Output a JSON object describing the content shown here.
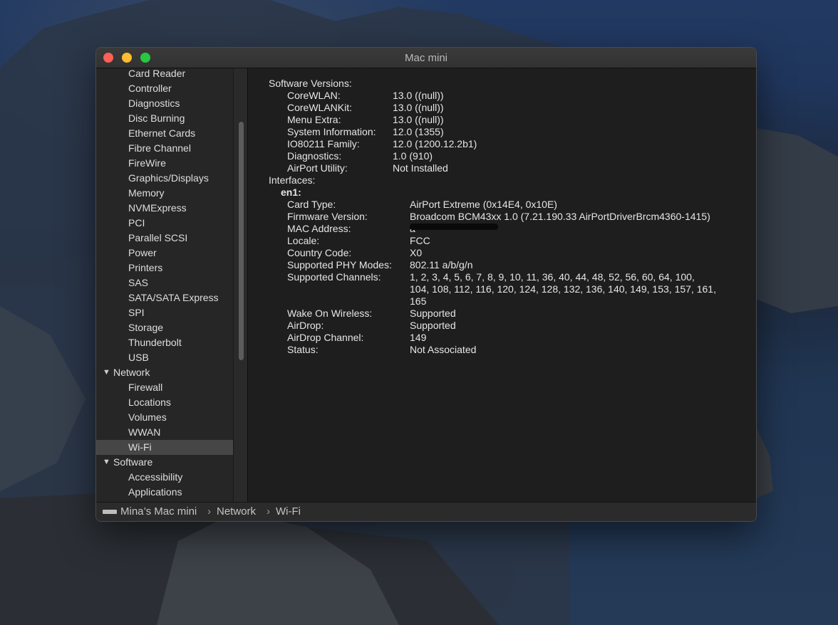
{
  "window": {
    "title": "Mac mini"
  },
  "sidebar": {
    "items": [
      {
        "label": "Card Reader",
        "level": 2
      },
      {
        "label": "Controller",
        "level": 2
      },
      {
        "label": "Diagnostics",
        "level": 2
      },
      {
        "label": "Disc Burning",
        "level": 2
      },
      {
        "label": "Ethernet Cards",
        "level": 2
      },
      {
        "label": "Fibre Channel",
        "level": 2
      },
      {
        "label": "FireWire",
        "level": 2
      },
      {
        "label": "Graphics/Displays",
        "level": 2
      },
      {
        "label": "Memory",
        "level": 2
      },
      {
        "label": "NVMExpress",
        "level": 2
      },
      {
        "label": "PCI",
        "level": 2
      },
      {
        "label": "Parallel SCSI",
        "level": 2
      },
      {
        "label": "Power",
        "level": 2
      },
      {
        "label": "Printers",
        "level": 2
      },
      {
        "label": "SAS",
        "level": 2
      },
      {
        "label": "SATA/SATA Express",
        "level": 2
      },
      {
        "label": "SPI",
        "level": 2
      },
      {
        "label": "Storage",
        "level": 2
      },
      {
        "label": "Thunderbolt",
        "level": 2
      },
      {
        "label": "USB",
        "level": 2
      },
      {
        "label": "Network",
        "level": 1,
        "expanded": true
      },
      {
        "label": "Firewall",
        "level": 2
      },
      {
        "label": "Locations",
        "level": 2
      },
      {
        "label": "Volumes",
        "level": 2
      },
      {
        "label": "WWAN",
        "level": 2
      },
      {
        "label": "Wi-Fi",
        "level": 2,
        "selected": true
      },
      {
        "label": "Software",
        "level": 1,
        "expanded": true
      },
      {
        "label": "Accessibility",
        "level": 2
      },
      {
        "label": "Applications",
        "level": 2
      }
    ],
    "expand_glyph": "▼"
  },
  "content": {
    "software_versions_heading": "Software Versions:",
    "software_versions": [
      {
        "label": "CoreWLAN:",
        "value": "13.0 ((null))"
      },
      {
        "label": "CoreWLANKit:",
        "value": "13.0 ((null))"
      },
      {
        "label": "Menu Extra:",
        "value": "13.0 ((null))"
      },
      {
        "label": "System Information:",
        "value": "12.0 (1355)"
      },
      {
        "label": "IO80211 Family:",
        "value": "12.0 (1200.12.2b1)"
      },
      {
        "label": "Diagnostics:",
        "value": "1.0 (910)"
      },
      {
        "label": "AirPort Utility:",
        "value": "Not Installed"
      }
    ],
    "interfaces_heading": "Interfaces:",
    "interface_name": "en1:",
    "interface_fields": [
      {
        "label": "Card Type:",
        "value": "AirPort Extreme  (0x14E4, 0x10E)"
      },
      {
        "label": "Firmware Version:",
        "value": "Broadcom BCM43xx 1.0 (7.21.190.33 AirPortDriverBrcm4360-1415)"
      },
      {
        "label": "MAC Address:",
        "value": "a"
      },
      {
        "label": "Locale:",
        "value": "FCC"
      },
      {
        "label": "Country Code:",
        "value": "X0"
      },
      {
        "label": "Supported PHY Modes:",
        "value": "802.11 a/b/g/n"
      },
      {
        "label": "Supported Channels:",
        "value": "1, 2, 3, 4, 5, 6, 7, 8, 9, 10, 11, 36, 40, 44, 48, 52, 56, 60, 64, 100,",
        "value2": "104, 108, 112, 116, 120, 124, 128, 132, 136, 140, 149, 153, 157, 161,",
        "value3": "165"
      },
      {
        "label": "Wake On Wireless:",
        "value": "Supported"
      },
      {
        "label": "AirDrop:",
        "value": "Supported"
      },
      {
        "label": "AirDrop Channel:",
        "value": "149"
      },
      {
        "label": "Status:",
        "value": "Not Associated"
      }
    ]
  },
  "pathbar": {
    "segments": [
      "Mina’s Mac mini",
      "Network",
      "Wi-Fi"
    ],
    "separator": "›"
  }
}
